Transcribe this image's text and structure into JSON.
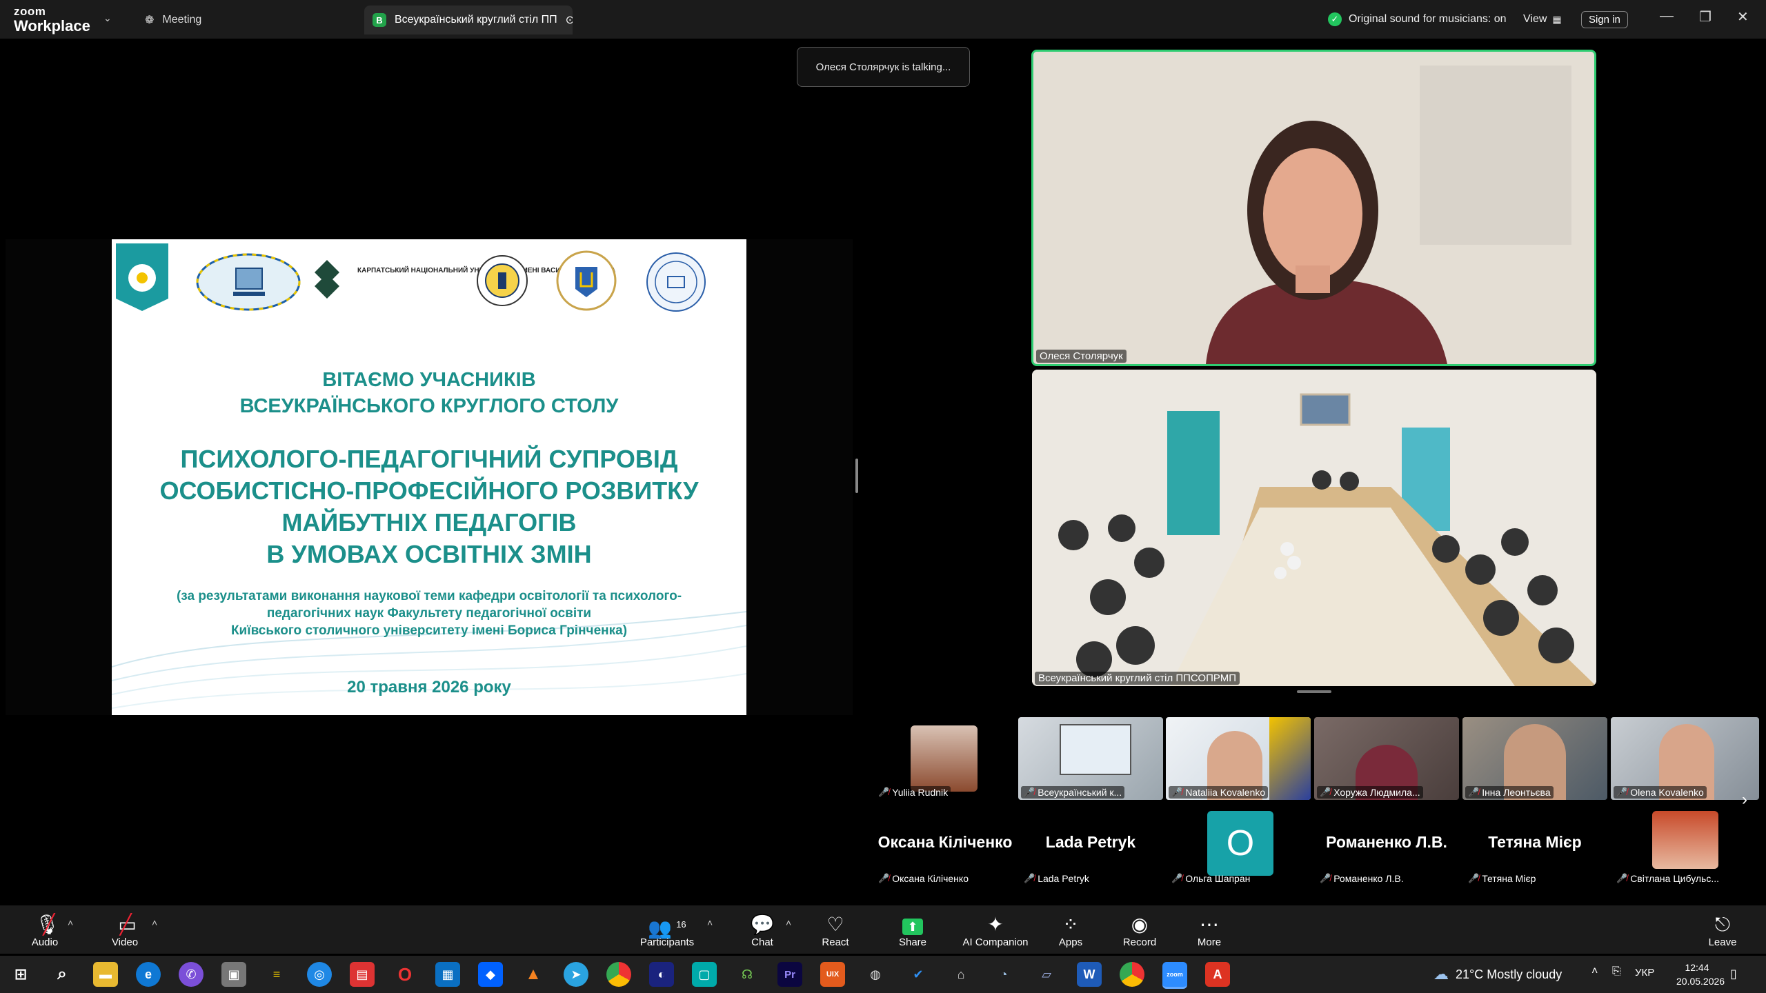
{
  "titlebar": {
    "brand_top": "zoom",
    "brand_bottom": "Workplace",
    "meeting_tab": "Meeting",
    "active_tab_badge": "В",
    "active_tab": "Всеукраїнський круглий стіл ПП",
    "original_sound": "Original sound for musicians: on",
    "view": "View",
    "sign_in": "Sign in"
  },
  "talking_toast": "Олеся Столярчук is talking...",
  "slide": {
    "greeting_line1": "ВІТАЄМО УЧАСНИКІВ",
    "greeting_line2": "ВСЕУКРАЇНСЬКОГО КРУГЛОГО СТОЛУ",
    "topic_line1": "ПСИХОЛОГО-ПЕДАГОГІЧНИЙ СУПРОВІД",
    "topic_line2": "ОСОБИСТІСНО-ПРОФЕСІЙНОГО РОЗВИТКУ",
    "topic_line3": "МАЙБУТНІХ ПЕДАГОГІВ",
    "topic_line4": "В УМОВАХ ОСВІТНІХ ЗМІН",
    "note_line1": "(за результатами виконання наукової теми кафедри освітології та психолого-",
    "note_line2": "педагогічних наук Факультету педагогічної освіти",
    "note_line3": "Київського столичного університету імені Бориса Грінченка)",
    "date": "20 травня 2026 року",
    "logo_text": "КАРПАТСЬКИЙ НАЦІОНАЛЬНИЙ УНІВЕРСИТЕТ ІМЕНІ ВАСИЛЯ СТЕФАНИКА"
  },
  "speakers": [
    {
      "name": "Олеся Столярчук"
    },
    {
      "name": "Всеукраїнський круглий стіл ППСОПРМП"
    }
  ],
  "thumbnails": [
    {
      "name": "Yuliia Rudnik"
    },
    {
      "name": "Всеукраїнський к..."
    },
    {
      "name": "Nataliia Kovalenko"
    },
    {
      "name": "Хоружа Людмила..."
    },
    {
      "name": "Інна Леонтьєва"
    },
    {
      "name": "Olena Kovalenko"
    }
  ],
  "name_tiles": [
    {
      "display": "Оксана Кіліченко",
      "label": "Оксана Кіліченко"
    },
    {
      "display": "Lada Petryk",
      "label": "Lada Petryk"
    },
    {
      "display": "О",
      "label": "Ольга Шапран"
    },
    {
      "display": "Романенко Л.В.",
      "label": "Романенко Л.В."
    },
    {
      "display": "Тетяна Мієр",
      "label": "Тетяна Мієр"
    },
    {
      "display": "",
      "label": "Світлана Цибульс..."
    }
  ],
  "toolbar": {
    "audio": "Audio",
    "video": "Video",
    "participants": "Participants",
    "participants_count": "16",
    "chat": "Chat",
    "react": "React",
    "share": "Share",
    "ai_companion": "AI Companion",
    "apps": "Apps",
    "record": "Record",
    "more": "More",
    "leave": "Leave"
  },
  "taskbar": {
    "weather": "21°C  Mostly cloudy",
    "lang": "УКР",
    "time": "12:44",
    "date": "20.05.2026"
  },
  "colors": {
    "accent_teal": "#1b8f8a",
    "speaker_border": "#2ecc71",
    "share_green": "#22c55e",
    "leave_red": "#e02424"
  }
}
